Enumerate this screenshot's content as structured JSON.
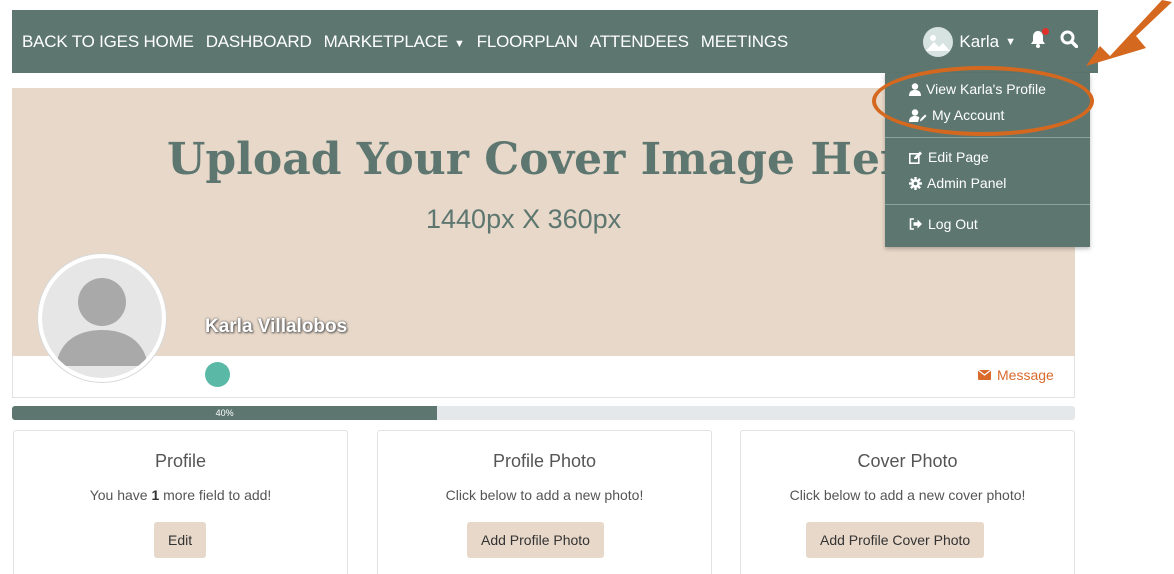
{
  "nav": {
    "items": [
      {
        "label": "BACK TO IGES HOME"
      },
      {
        "label": "DASHBOARD"
      },
      {
        "label": "MARKETPLACE"
      },
      {
        "label": "FLOORPLAN"
      },
      {
        "label": "ATTENDEES"
      },
      {
        "label": "MEETINGS"
      }
    ],
    "user_name": "Karla"
  },
  "dropdown": {
    "view_profile": "View Karla's Profile",
    "my_account": "My Account",
    "edit_page": "Edit Page",
    "admin_panel": "Admin Panel",
    "log_out": "Log Out"
  },
  "cover": {
    "title": "Upload Your Cover Image Here",
    "subtitle": "1440px X 360px"
  },
  "profile": {
    "display_name": "Karla Villalobos",
    "message_label": "Message"
  },
  "progress": {
    "percent": 40,
    "label": "40%"
  },
  "cards": {
    "profile": {
      "title": "Profile",
      "desc_before": "You have ",
      "desc_count": "1",
      "desc_after": " more field to add!",
      "button": "Edit"
    },
    "photo": {
      "title": "Profile Photo",
      "desc": "Click below to add a new photo!",
      "button": "Add Profile Photo"
    },
    "cover": {
      "title": "Cover Photo",
      "desc": "Click below to add a new cover photo!",
      "button": "Add Profile Cover Photo"
    }
  },
  "colors": {
    "nav_bg": "#5d7770",
    "cover_bg": "#e8d8c9",
    "accent_orange": "#d5681f",
    "message_orange": "#d96a2c",
    "status_teal": "#5ab8a7"
  },
  "icons": [
    "chevron-down-icon",
    "user-avatar-icon",
    "bell-icon",
    "search-icon",
    "user-icon",
    "user-edit-icon",
    "edit-icon",
    "gear-icon",
    "logout-icon",
    "envelope-icon",
    "arrow-annotation"
  ]
}
